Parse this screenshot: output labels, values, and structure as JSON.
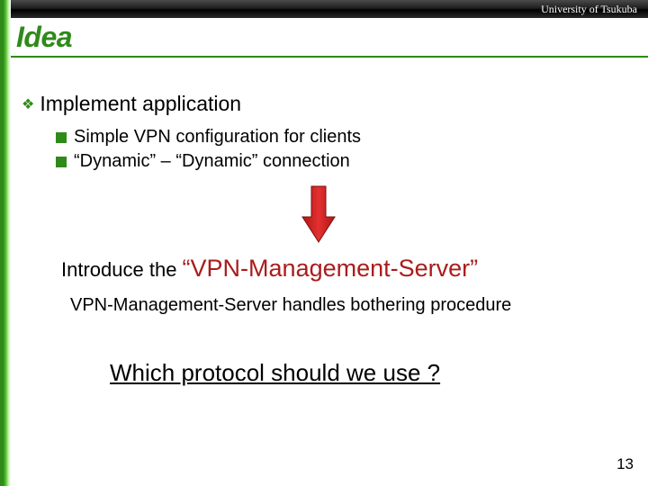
{
  "header": {
    "university": "University of Tsukuba"
  },
  "title": "Idea",
  "bullets": {
    "lvl1": "Implement application",
    "sub": [
      "Simple VPN configuration for clients",
      "“Dynamic” – “Dynamic” connection"
    ]
  },
  "intro": {
    "prefix": "Introduce the ",
    "highlight": "“VPN-Management-Server”"
  },
  "subline": "VPN-Management-Server handles bothering procedure",
  "question": "Which protocol should we use ?",
  "page": "13"
}
